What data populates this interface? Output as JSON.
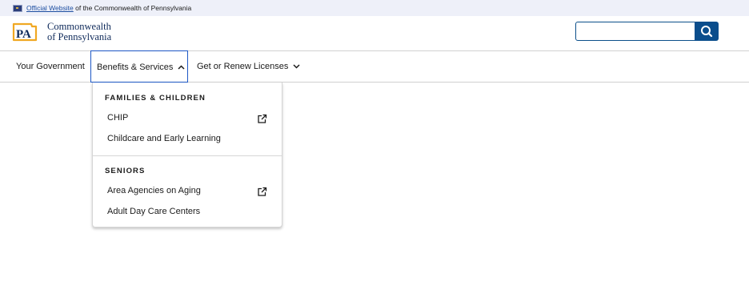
{
  "banner": {
    "official_link": "Official Website",
    "suffix": "of the Commonwealth of Pennsylvania"
  },
  "header": {
    "logo_line1": "Commonwealth",
    "logo_line2": "of Pennsylvania",
    "logo_mark": "PA",
    "search_placeholder": ""
  },
  "nav": {
    "items": [
      {
        "label": "Your Government"
      },
      {
        "label": "Benefits & Services",
        "expanded": true
      },
      {
        "label": "Get or Renew Licenses"
      }
    ]
  },
  "dropdown": {
    "groups": [
      {
        "title": "FAMILIES & CHILDREN",
        "links": [
          {
            "label": "CHIP",
            "external": true
          },
          {
            "label": "Childcare and Early Learning",
            "external": false
          }
        ]
      },
      {
        "title": "SENIORS",
        "links": [
          {
            "label": "Area Agencies on Aging",
            "external": true
          },
          {
            "label": "Adult Day Care Centers",
            "external": false
          }
        ]
      }
    ]
  },
  "colors": {
    "banner_bg": "#eef0f9",
    "link_blue": "#1d4ea1",
    "brand_navy": "#0f2a5a",
    "logo_gold": "#f0a823",
    "search_button": "#0a4d8c",
    "focus_outline": "#1d57c5"
  },
  "icons": {
    "flag": "us-flag-icon",
    "search": "search-icon",
    "chevron_up": "chevron-up-icon",
    "chevron_down": "chevron-down-icon",
    "external": "external-link-icon"
  }
}
